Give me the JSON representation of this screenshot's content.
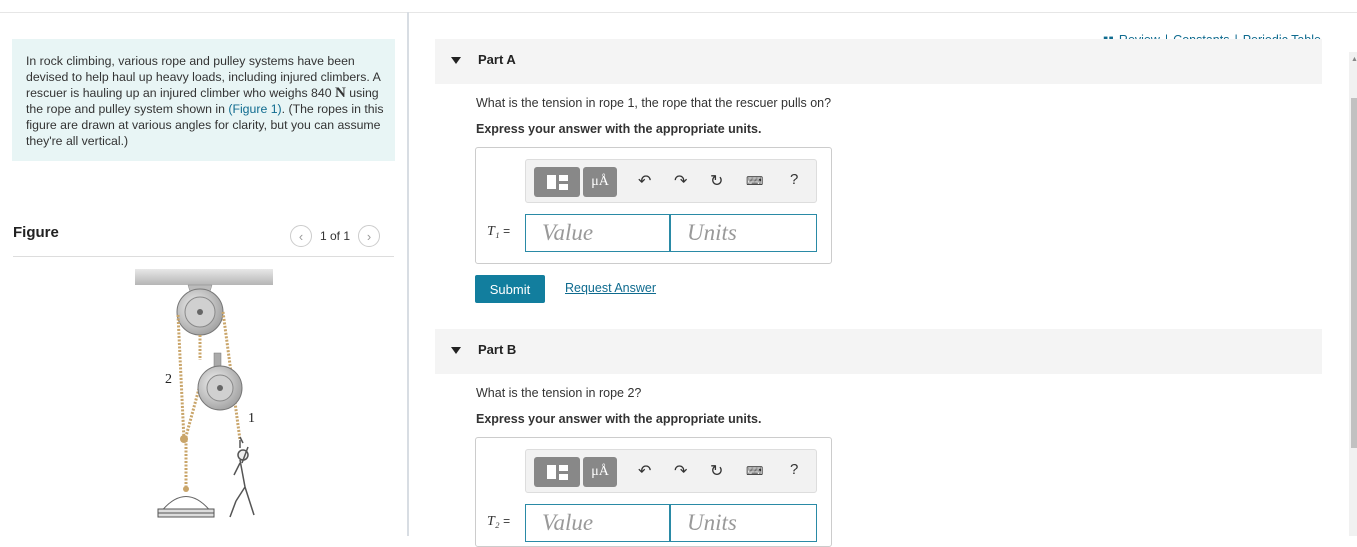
{
  "intro": {
    "text_before_n": "In rock climbing, various rope and pulley systems have been devised to help haul up heavy loads, including injured climbers. A rescuer is hauling up an injured climber who weighs 840 ",
    "weight_unit": "N",
    "text_after_n": " using the rope and pulley system shown in ",
    "figure_link": "(Figure 1)",
    "text_end": ". (The ropes in this figure are drawn at various angles for clarity, but you can assume they're all vertical.)"
  },
  "figure": {
    "heading": "Figure",
    "pager": "1 of 1",
    "label_rope2": "2",
    "label_rope1": "1"
  },
  "toplinks": {
    "review": "Review",
    "sep1": "|",
    "constants": "Constants",
    "sep2": "|",
    "periodic": "Periodic Table"
  },
  "partA": {
    "title": "Part A",
    "question": "What is the tension in rope 1, the rope that the rescuer pulls on?",
    "express": "Express your answer with the appropriate units.",
    "label": "T₁",
    "eq": "=",
    "value_placeholder": "Value",
    "units_placeholder": "Units",
    "units_btn": "μÅ",
    "help": "?"
  },
  "actions": {
    "submit": "Submit",
    "request": "Request Answer"
  },
  "partB": {
    "title": "Part B",
    "question": "What is the tension in rope 2?",
    "express": "Express your answer with the appropriate units.",
    "label": "T₂",
    "eq": "=",
    "value_placeholder": "Value",
    "units_placeholder": "Units",
    "units_btn": "μÅ",
    "help": "?"
  },
  "icons": {
    "undo": "undo-icon",
    "redo": "redo-icon",
    "reset": "reset-icon",
    "keyboard": "keyboard-icon"
  },
  "colors": {
    "accent": "#127e9e",
    "link": "#0f6b8f",
    "intro_bg": "#e8f5f5",
    "part_header_bg": "#f4f4f4"
  }
}
